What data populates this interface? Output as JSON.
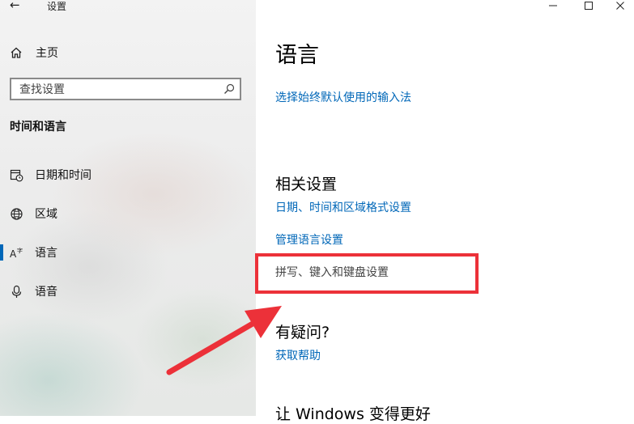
{
  "window": {
    "title": "设置",
    "back_glyph": "←",
    "controls": [
      "minimize",
      "maximize",
      "close"
    ]
  },
  "sidebar": {
    "home_label": "主页",
    "search_placeholder": "查找设置",
    "section_title": "时间和语言",
    "items": [
      {
        "label": "日期和时间",
        "icon": "calendar-clock-icon",
        "active": false
      },
      {
        "label": "区域",
        "icon": "globe-icon",
        "active": false
      },
      {
        "label": "语言",
        "icon": "language-icon",
        "active": true
      },
      {
        "label": "语音",
        "icon": "microphone-icon",
        "active": false
      }
    ]
  },
  "main": {
    "title": "语言",
    "default_input_link": "选择始终默认使用的输入法",
    "related_settings": {
      "heading": "相关设置",
      "links": [
        "日期、时间和区域格式设置",
        "管理语言设置",
        "拼写、键入和键盘设置"
      ]
    },
    "questions": {
      "heading": "有疑问?",
      "link": "获取帮助"
    },
    "better_heading": "让 Windows 变得更好"
  },
  "colors": {
    "accent": "#0067b8",
    "annotation_red": "#ec3139"
  }
}
